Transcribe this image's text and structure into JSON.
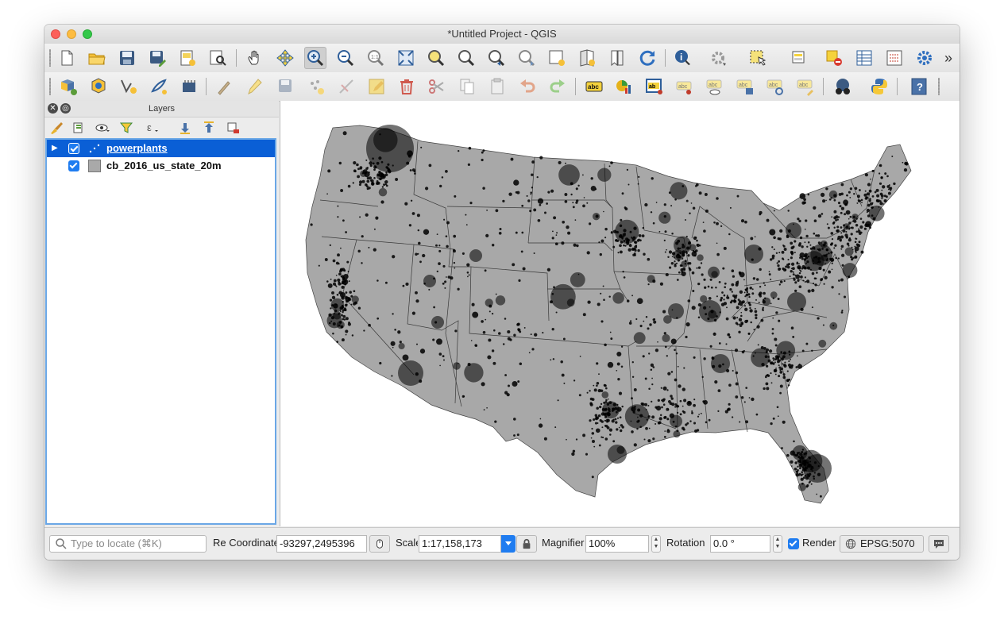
{
  "window": {
    "title": "*Untitled Project - QGIS"
  },
  "toolbar_main": {
    "items": [
      "new-project",
      "open-project",
      "save-project",
      "save-project-as",
      "new-print-layout",
      "show-layout-manager",
      "pan-map",
      "pan-to-selection",
      "zoom-in",
      "zoom-out",
      "zoom-native",
      "zoom-full",
      "zoom-to-selection",
      "zoom-to-layer",
      "zoom-last",
      "zoom-next",
      "new-map-view",
      "new-3d-map-view",
      "new-spatial-bookmark",
      "show-bookmarks",
      "refresh",
      "identify-features",
      "action-run",
      "select-features",
      "select-by-value",
      "deselect-all",
      "open-attribute-table",
      "statistical-summary",
      "measure-line"
    ],
    "more": "»"
  },
  "toolbar_digitize": {
    "items": [
      "data-source-manager",
      "new-geopackage-layer",
      "new-shapefile-layer",
      "virtual-layer",
      "gps-tools",
      "current-edits",
      "toggle-editing",
      "save-edits",
      "add-feature",
      "move-feature",
      "vertex-tool",
      "delete-selected",
      "cut-features",
      "copy-features",
      "paste-features",
      "undo",
      "redo",
      "layer-labeling",
      "layer-diagram",
      "highlight-pinned-labels",
      "pin-labels",
      "show-hide-labels",
      "move-label",
      "rotate-label",
      "change-label",
      "style-manager",
      "python-console",
      "help"
    ]
  },
  "layers_panel": {
    "title": "Layers",
    "tools": [
      "open-layer-styling",
      "add-group",
      "manage-map-themes",
      "filter-legend",
      "filter-by-expression",
      "expand-all",
      "collapse-all",
      "remove-layer"
    ],
    "layers": [
      {
        "name": "powerplants",
        "checked": true,
        "selected": true,
        "symbol": "point"
      },
      {
        "name": "cb_2016_us_state_20m",
        "checked": true,
        "selected": false,
        "symbol": "polygon",
        "fill": "#a9a9a9"
      }
    ]
  },
  "map": {
    "state_fill": "#a8a8a8",
    "point_color": "#000000"
  },
  "statusbar": {
    "locator_placeholder": "Type to locate (⌘K)",
    "coord_label": "Re Coordinate",
    "coordinate": "-93297,2495396",
    "scale_label": "Scale",
    "scale": "1:17,158,173",
    "magnifier_label": "Magnifier",
    "magnifier": "100%",
    "rotation_label": "Rotation",
    "rotation": "0.0 °",
    "render_label": "Render",
    "render_checked": true,
    "crs": "EPSG:5070"
  }
}
